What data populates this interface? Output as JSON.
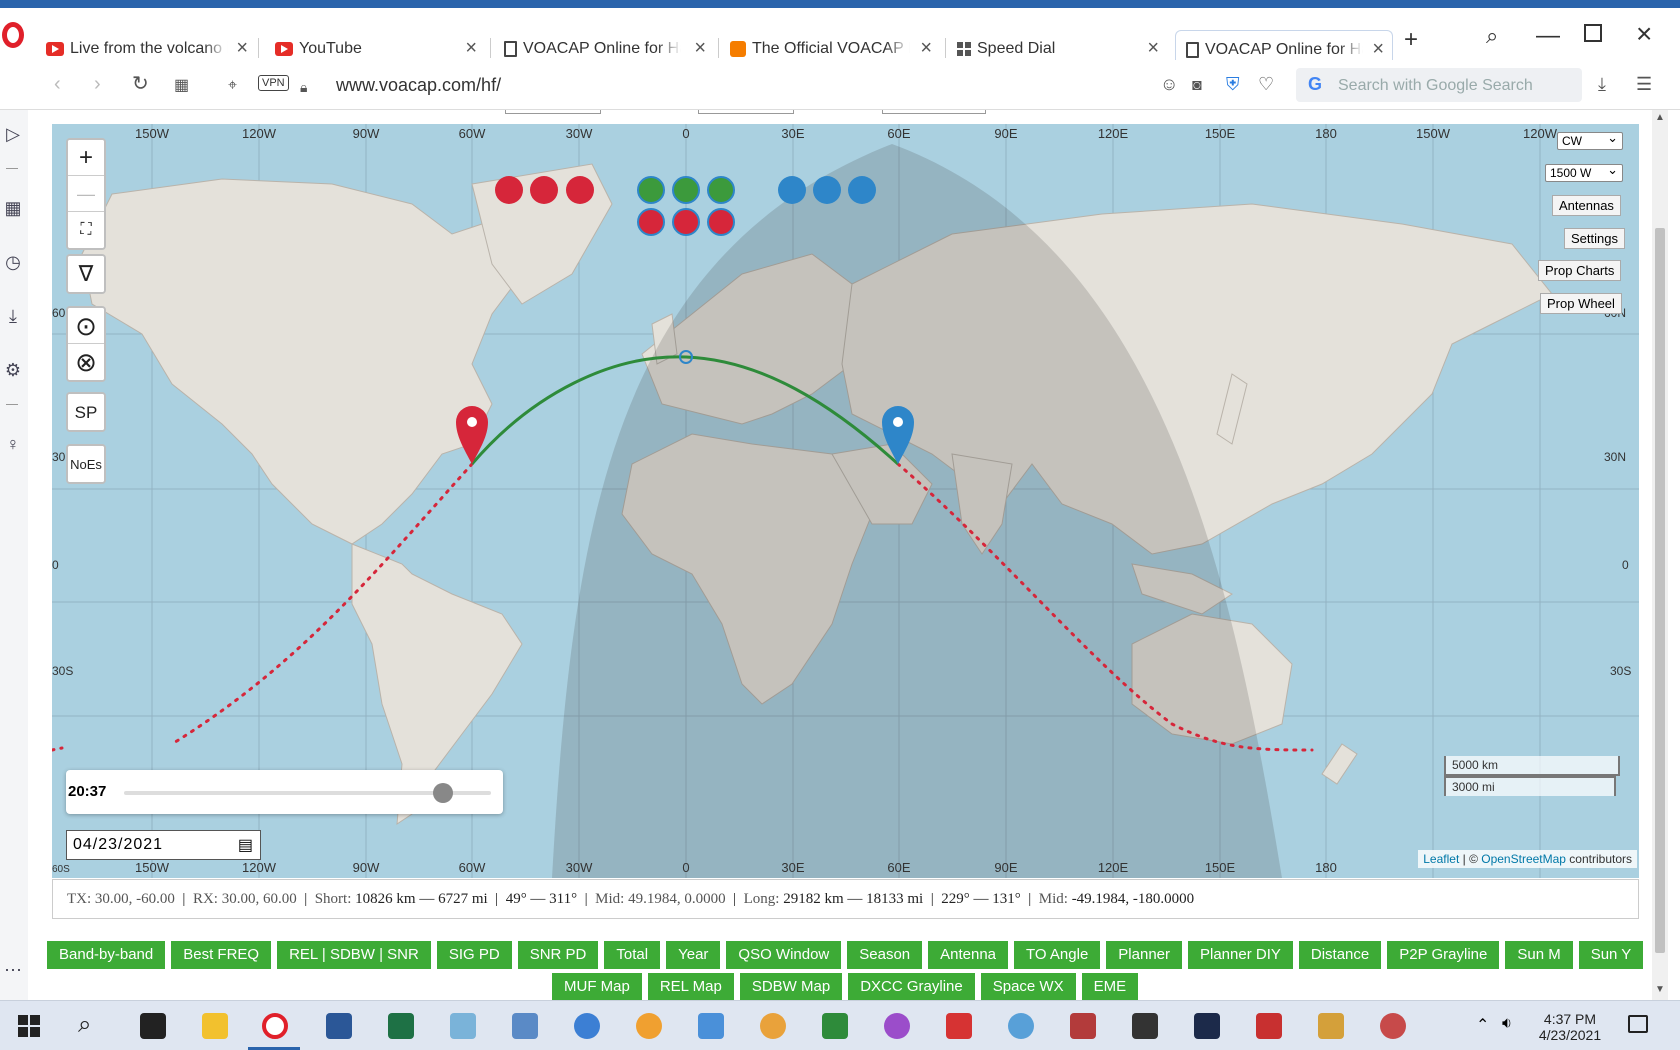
{
  "browser": {
    "tabs": [
      {
        "label": "Live from the volcano in",
        "icon": "youtube-icon"
      },
      {
        "label": "YouTube",
        "icon": "youtube-icon"
      },
      {
        "label": "VOACAP Online for Ham",
        "icon": "document-icon"
      },
      {
        "label": "The Official VOACAP Blo",
        "icon": "blogger-icon"
      },
      {
        "label": "Speed Dial",
        "icon": "speed-dial-icon"
      },
      {
        "label": "VOACAP Online for Ham",
        "icon": "document-icon"
      }
    ],
    "url": "www.voacap.com/hf/",
    "vpn_label": "VPN",
    "search_placeholder": "Search with Google Search",
    "new_tab_symbol": "+"
  },
  "map": {
    "lon_labels": [
      "150W",
      "120W",
      "90W",
      "60W",
      "30W",
      "0",
      "30E",
      "60E",
      "90E",
      "120E",
      "150E",
      "180",
      "150W",
      "120W"
    ],
    "lat_labels_left": [
      "60",
      "30",
      "0",
      "30S",
      "60S"
    ],
    "lat_labels_right": [
      "60N",
      "30N",
      "0",
      "30S",
      "60S"
    ],
    "mode_select": "CW",
    "power_select": "1500 W",
    "side_buttons": [
      "Antennas",
      "Settings",
      "Prop Charts",
      "Prop Wheel"
    ],
    "left_controls": {
      "zoom_in": "+",
      "zoom_out": "—",
      "sp": "SP",
      "noes": "NoEs"
    },
    "time": "20:37",
    "time_fraction": 0.87,
    "date": "04/23/2021",
    "scale_km": "5000 km",
    "scale_mi": "3000 mi",
    "attribution_leaflet": "Leaflet",
    "attribution_sep": " | © ",
    "attribution_osm": "OpenStreetMap",
    "attribution_tail": " contributors",
    "tx_marker_color": "#d6263a",
    "rx_marker_color": "#2e86c9",
    "short_path_color": "#2e8b3a",
    "long_path_color": "#d6263a",
    "indicator_rows": [
      {
        "color": "#d6263a",
        "count": 3
      },
      {
        "colors": [
          "#3c9a3c",
          "#3c9a3c",
          "#3c9a3c"
        ],
        "second_row": [
          "#d6263a",
          "#d6263a",
          "#d6263a"
        ]
      },
      {
        "color": "#2e86c9",
        "count": 3
      }
    ]
  },
  "info": {
    "tx": "TX: 30.00, -60.00",
    "rx": "RX: 30.00, 60.00",
    "short_label": "Short:",
    "short_value": "10826 km — 6727 mi",
    "short_az": "49° — 311°",
    "mid_label": "Mid:",
    "mid_value": "49.1984, 0.0000",
    "long_label": "Long:",
    "long_value": "29182 km — 18133 mi",
    "long_az": "229° — 131°",
    "mid2_value": "-49.1984, -180.0000"
  },
  "buttons_row1": [
    "Band-by-band",
    "Best FREQ",
    "REL | SDBW | SNR",
    "SIG PD",
    "SNR PD",
    "Total",
    "Year",
    "QSO Window",
    "Season",
    "Antenna",
    "TO Angle",
    "Planner",
    "Planner DIY",
    "Distance",
    "P2P Grayline",
    "Sun M",
    "Sun Y"
  ],
  "buttons_row2": [
    "MUF Map",
    "REL Map",
    "SDBW Map",
    "DXCC Grayline",
    "Space WX",
    "EME"
  ],
  "taskbar": {
    "time": "4:37 PM",
    "date": "4/23/2021"
  }
}
